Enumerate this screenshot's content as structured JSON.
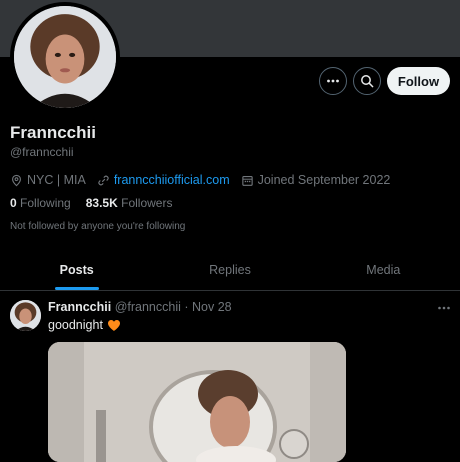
{
  "profile": {
    "display_name": "Franncchii",
    "handle": "@franncchii",
    "location": "NYC | MIA",
    "link": "franncchiiofficial.com",
    "joined": "Joined September 2022",
    "following_count": "0",
    "following_label": "Following",
    "followers_count": "83.5K",
    "followers_label": "Followers",
    "not_followed_text": "Not followed by anyone you're following"
  },
  "actions": {
    "follow_label": "Follow",
    "more_icon": "more-icon",
    "search_icon": "search-icon"
  },
  "tabs": [
    {
      "label": "Posts",
      "active": true
    },
    {
      "label": "Replies",
      "active": false
    },
    {
      "label": "Media",
      "active": false
    }
  ],
  "tweet": {
    "name": "Franncchii",
    "handle": "@franncchii",
    "separator": "·",
    "date": "Nov 28",
    "text": "goodnight",
    "emoji_icon": "orange-heart-icon"
  },
  "colors": {
    "accent": "#1d9bf0",
    "background": "#000000",
    "banner": "#333639",
    "muted_text": "#71767b",
    "heart": "#ff8c1a"
  }
}
